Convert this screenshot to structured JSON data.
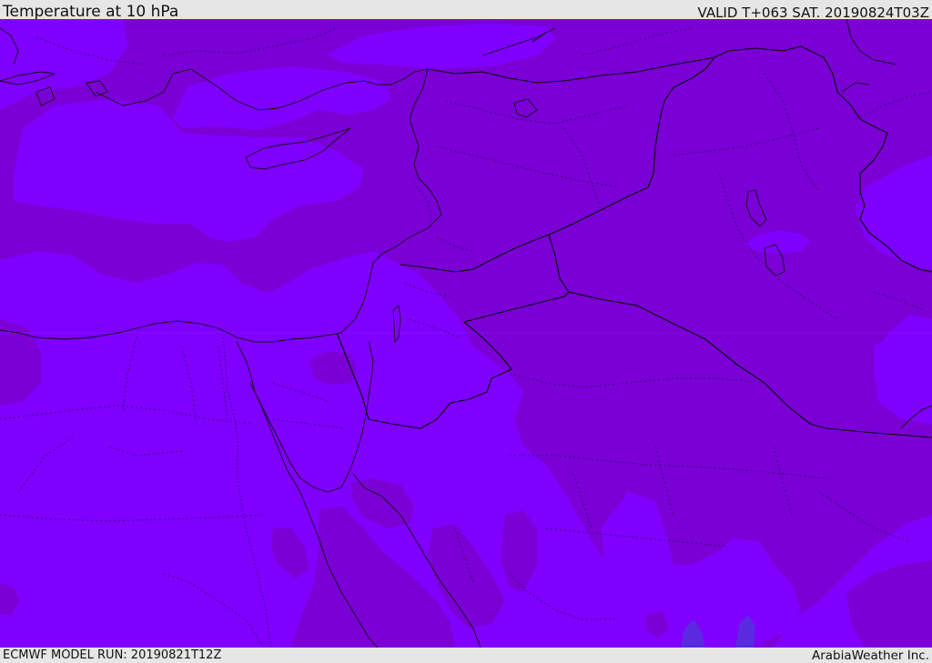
{
  "header": {
    "title": "Temperature at 10 hPa",
    "valid": "VALID T+063 SAT. 20190824T03Z"
  },
  "footer": {
    "model_run": "ECMWF MODEL RUN: 20190821T12Z",
    "credit": "ArabiaWeather Inc."
  },
  "map": {
    "colors": {
      "warm_band": "#7f00ff",
      "cool_band": "#7a00d6",
      "cold_spot": "#5a2ae0",
      "coastline": "#101010",
      "border": "#000000",
      "admin": "#2a0a55"
    }
  }
}
